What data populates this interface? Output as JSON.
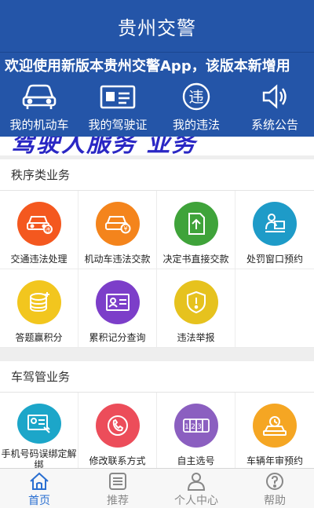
{
  "app": {
    "title": "贵州交警"
  },
  "marquee": "欢迎使用新版本贵州交警App，该版本新增用",
  "quick_nav": [
    {
      "label": "我的机动车",
      "icon": "car-icon"
    },
    {
      "label": "我的驾驶证",
      "icon": "license-card-icon"
    },
    {
      "label": "我的违法",
      "icon": "violation-icon"
    },
    {
      "label": "系统公告",
      "icon": "speaker-icon"
    }
  ],
  "banner": {
    "text": "驾驶人服务 业务"
  },
  "sections": [
    {
      "title": "秩序类业务",
      "items": [
        {
          "label": "交通违法处理",
          "icon": "car-violation-icon",
          "color": "#f4581f"
        },
        {
          "label": "机动车违法交款",
          "icon": "car-payment-icon",
          "color": "#f4841c"
        },
        {
          "label": "决定书直接交款",
          "icon": "document-payment-icon",
          "color": "#3fa33a"
        },
        {
          "label": "处罚窗口预约",
          "icon": "window-appointment-icon",
          "color": "#1e9bc8"
        },
        {
          "label": "答题赢积分",
          "icon": "coins-icon",
          "color": "#f2c61e"
        },
        {
          "label": "累积记分查询",
          "icon": "id-card-icon",
          "color": "#7c3ec9"
        },
        {
          "label": "违法举报",
          "icon": "alert-shield-icon",
          "color": "#e6c21e"
        },
        {
          "label": "",
          "icon": "",
          "color": ""
        }
      ]
    },
    {
      "title": "车驾管业务",
      "items": [
        {
          "label": "手机号码误绑定解绑",
          "icon": "phone-card-icon",
          "color": "#1ca6c9"
        },
        {
          "label": "修改联系方式",
          "icon": "phone-call-icon",
          "color": "#ec4d5a"
        },
        {
          "label": "自主选号",
          "icon": "plate-number-icon",
          "color": "#8b5fc0"
        },
        {
          "label": "车辆年审预约",
          "icon": "car-inspection-icon",
          "color": "#f5a623"
        }
      ]
    }
  ],
  "tabs": [
    {
      "label": "首页",
      "icon": "home-icon",
      "active": true
    },
    {
      "label": "推荐",
      "icon": "list-icon",
      "active": false
    },
    {
      "label": "个人中心",
      "icon": "user-icon",
      "active": false
    },
    {
      "label": "帮助",
      "icon": "help-icon",
      "active": false
    }
  ],
  "colors": {
    "header": "#2455a8",
    "active_tab": "#2a6fd1",
    "inactive_tab": "#888888"
  }
}
